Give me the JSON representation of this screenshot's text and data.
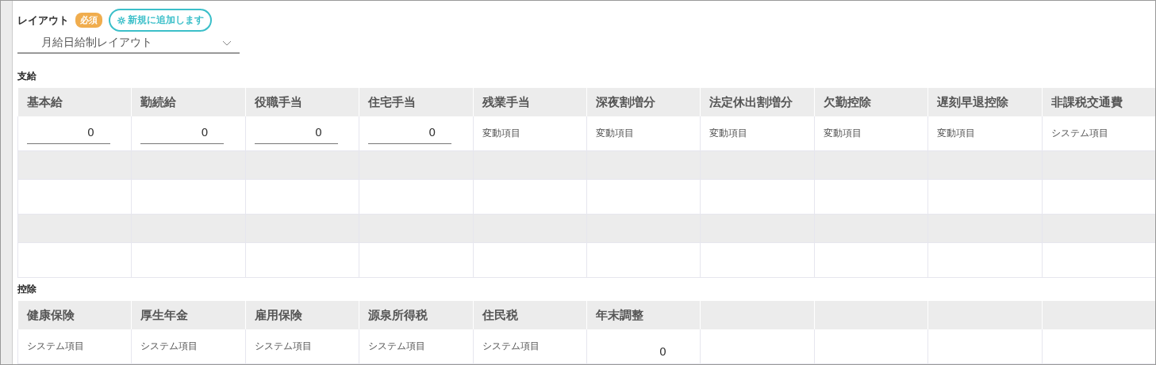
{
  "layout": {
    "label": "レイアウト",
    "required_badge": "必須",
    "add_button": "新規に追加します",
    "select_value": "月給日給制レイアウト"
  },
  "earnings": {
    "title": "支給",
    "columns": [
      "基本給",
      "勤続給",
      "役職手当",
      "住宅手当",
      "残業手当",
      "深夜割増分",
      "法定休出割増分",
      "欠勤控除",
      "遅刻早退控除",
      "非課税交通費"
    ],
    "cells": [
      {
        "kind": "input",
        "value": "0"
      },
      {
        "kind": "input",
        "value": "0"
      },
      {
        "kind": "input",
        "value": "0"
      },
      {
        "kind": "input",
        "value": "0"
      },
      {
        "kind": "text",
        "value": "変動項目"
      },
      {
        "kind": "text",
        "value": "変動項目"
      },
      {
        "kind": "text",
        "value": "変動項目"
      },
      {
        "kind": "text",
        "value": "変動項目"
      },
      {
        "kind": "text",
        "value": "変動項目"
      },
      {
        "kind": "text",
        "value": "システム項目"
      }
    ]
  },
  "deductions": {
    "title": "控除",
    "columns": [
      "健康保険",
      "厚生年金",
      "雇用保険",
      "源泉所得税",
      "住民税",
      "年末調整"
    ],
    "cells": [
      {
        "kind": "text",
        "value": "システム項目"
      },
      {
        "kind": "text",
        "value": "システム項目"
      },
      {
        "kind": "text",
        "value": "システム項目"
      },
      {
        "kind": "text",
        "value": "システム項目"
      },
      {
        "kind": "text",
        "value": "システム項目"
      },
      {
        "kind": "amount",
        "value": "0"
      }
    ]
  }
}
